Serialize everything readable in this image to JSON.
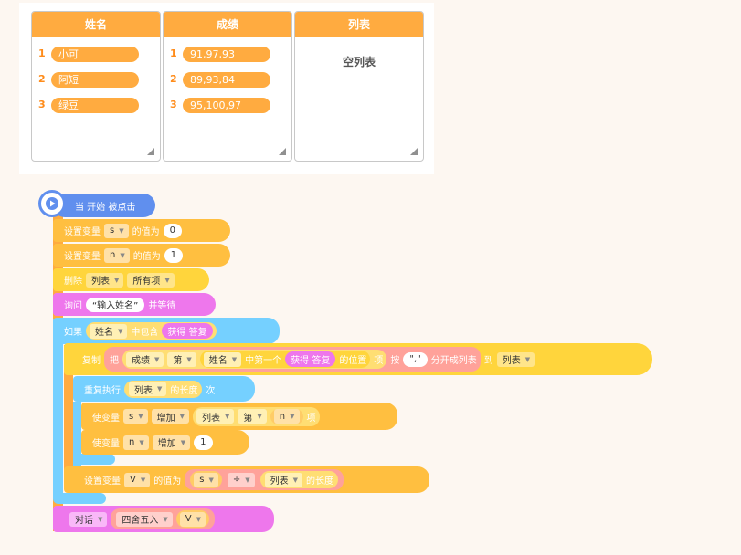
{
  "monitors": {
    "name_list": {
      "title": "姓名",
      "items": [
        "小可",
        "阿短",
        "绿豆"
      ]
    },
    "score_list": {
      "title": "成绩",
      "items": [
        "91,97,93",
        "89,93,84",
        "95,100,97"
      ]
    },
    "result_list": {
      "title": "列表",
      "empty_text": "空列表"
    }
  },
  "indices": [
    "1",
    "2",
    "3"
  ],
  "blocks": {
    "hat": {
      "label": "当 开始 被点击"
    },
    "set_s": {
      "set": "设置变量",
      "var": "s",
      "to": "的值为",
      "value": "0"
    },
    "set_n": {
      "set": "设置变量",
      "var": "n",
      "to": "的值为",
      "value": "1"
    },
    "delete": {
      "label": "删除",
      "list": "列表",
      "which": "所有项"
    },
    "ask": {
      "label": "询问",
      "question": "“输入姓名”",
      "wait": "并等待"
    },
    "if": {
      "label": "如果",
      "list": "姓名",
      "contains": "中包含",
      "answer": "获得 答复"
    },
    "copy": {
      "label": "复制",
      "ba": "把",
      "list": "成绩",
      "di": "第",
      "list2": "姓名",
      "first": "中第一个",
      "answer": "获得 答复",
      "pos": "的位置",
      "xiang": "项",
      "an": "按",
      "sep": "\",\"",
      "split": "分开成列表",
      "dao": "到",
      "target": "列表"
    },
    "repeat": {
      "label": "重复执行",
      "list": "列表",
      "length": "的长度",
      "times": "次"
    },
    "change_s": {
      "label": "使变量",
      "var": "s",
      "op": "增加",
      "list": "列表",
      "di": "第",
      "index": "n",
      "xiang": "项"
    },
    "change_n": {
      "label": "使变量",
      "var": "n",
      "op": "增加",
      "value": "1"
    },
    "set_v": {
      "set": "设置变量",
      "var": "V",
      "to": "的值为",
      "left": "s",
      "op": "÷",
      "list": "列表",
      "length": "的长度"
    },
    "say": {
      "label": "对话",
      "round": "四舍五入",
      "var": "V"
    }
  },
  "colors": {
    "control": "#ffab40",
    "variable": "#ffbf40",
    "list": "#ffd53c",
    "sensing": "#ee77ec",
    "repeat": "#75d0ff",
    "event": "#608fee"
  }
}
